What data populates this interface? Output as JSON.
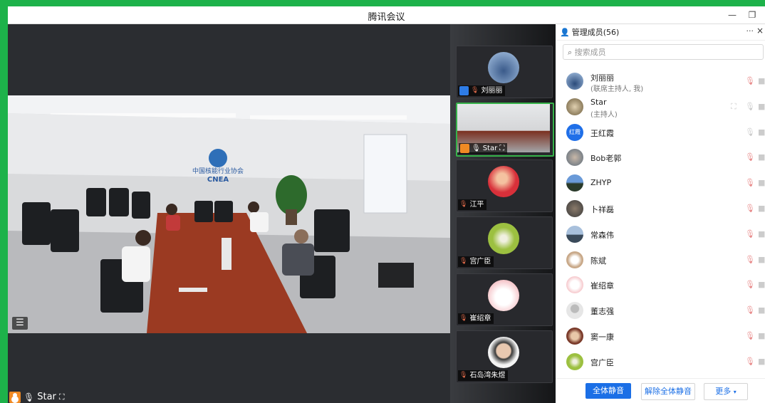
{
  "window": {
    "title": "腾讯会议"
  },
  "stage": {
    "speaker_label": "Star",
    "room_sign_cn": "中国核能行业协会",
    "room_sign_en": "CNEA"
  },
  "strip": {
    "tiles": [
      {
        "name": "刘丽丽",
        "badge": "blue"
      },
      {
        "name": "Star",
        "badge": "orange"
      },
      {
        "name": "江平"
      },
      {
        "name": "宫广臣"
      },
      {
        "name": "崔绍章"
      },
      {
        "name": "石岛湾朱煜"
      }
    ]
  },
  "panel": {
    "title": "管理成员(56)",
    "more_label": "···",
    "close_label": "×",
    "search_placeholder": "搜索成员",
    "members": [
      {
        "name": "刘丽丽",
        "role": "(联席主持人, 我)"
      },
      {
        "name": "Star",
        "role": "(主持人)"
      },
      {
        "name": "王红霞",
        "avatar_text": "红霞"
      },
      {
        "name": "Bob老郭"
      },
      {
        "name": "ZHYP"
      },
      {
        "name": "卜祥磊"
      },
      {
        "name": "常森伟"
      },
      {
        "name": "陈斌"
      },
      {
        "name": "崔绍章"
      },
      {
        "name": "董志强"
      },
      {
        "name": "窦一康"
      },
      {
        "name": "宫广臣"
      }
    ],
    "buttons": {
      "mute_all": "全体静音",
      "unmute_all": "解除全体静音",
      "more": "更多"
    }
  },
  "colors": {
    "accent": "#1b6fe6",
    "frame": "#1db24a",
    "host": "#f08a24"
  }
}
